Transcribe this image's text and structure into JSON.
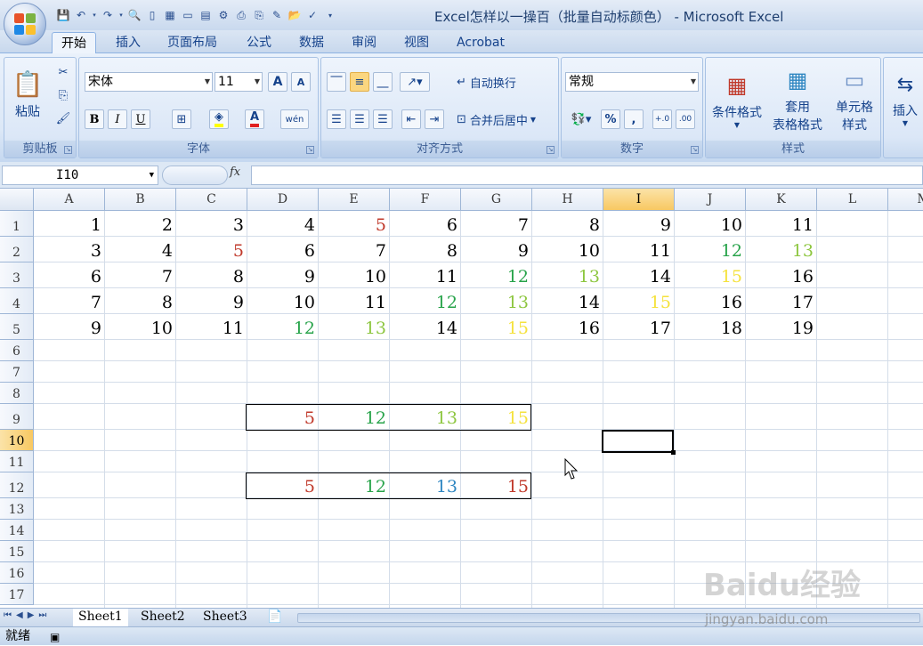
{
  "window": {
    "title": "Excel怎样以一操百（批量自动标颜色） - Microsoft Excel"
  },
  "tabs": [
    "开始",
    "插入",
    "页面布局",
    "公式",
    "数据",
    "审阅",
    "视图",
    "Acrobat"
  ],
  "ribbon": {
    "clipboard": {
      "label": "剪贴板",
      "paste": "粘贴"
    },
    "font": {
      "label": "字体",
      "name": "宋体",
      "size": "11",
      "grow": "A",
      "shrink": "A",
      "bold": "B",
      "italic": "I",
      "underline": "U",
      "fontcolor": "A",
      "phonetic": "wén"
    },
    "align": {
      "label": "对齐方式",
      "wrap": "自动换行",
      "merge": "合并后居中"
    },
    "number": {
      "label": "数字",
      "format": "常规",
      "percent": "%",
      "comma": ","
    },
    "styles": {
      "label": "样式",
      "cond": "条件格式",
      "table_line1": "套用",
      "table_line2": "表格格式",
      "cell_line1": "单元格",
      "cell_line2": "样式"
    },
    "cells": {
      "insert": "插入"
    }
  },
  "formula_bar": {
    "name_box": "I10",
    "fx": "fx",
    "formula": ""
  },
  "columns": [
    "A",
    "B",
    "C",
    "D",
    "E",
    "F",
    "G",
    "H",
    "I",
    "J",
    "K",
    "L",
    "M"
  ],
  "rows": [
    "1",
    "2",
    "3",
    "4",
    "5",
    "6",
    "7",
    "8",
    "9",
    "10",
    "11",
    "12",
    "13",
    "14",
    "15",
    "16",
    "17"
  ],
  "selected": {
    "column": "I",
    "row": "10"
  },
  "colors": {
    "red": "#c0392b",
    "green": "#27a34a",
    "lightgreen": "#8dc63f",
    "yellow": "#f5e23d",
    "blue": "#2e86c1",
    "black": "#000000"
  },
  "cells": [
    {
      "r": 1,
      "c": 0,
      "v": "1",
      "k": "black"
    },
    {
      "r": 1,
      "c": 1,
      "v": "2",
      "k": "black"
    },
    {
      "r": 1,
      "c": 2,
      "v": "3",
      "k": "black"
    },
    {
      "r": 1,
      "c": 3,
      "v": "4",
      "k": "black"
    },
    {
      "r": 1,
      "c": 4,
      "v": "5",
      "k": "red"
    },
    {
      "r": 1,
      "c": 5,
      "v": "6",
      "k": "black"
    },
    {
      "r": 1,
      "c": 6,
      "v": "7",
      "k": "black"
    },
    {
      "r": 1,
      "c": 7,
      "v": "8",
      "k": "black"
    },
    {
      "r": 1,
      "c": 8,
      "v": "9",
      "k": "black"
    },
    {
      "r": 1,
      "c": 9,
      "v": "10",
      "k": "black"
    },
    {
      "r": 1,
      "c": 10,
      "v": "11",
      "k": "black"
    },
    {
      "r": 2,
      "c": 0,
      "v": "3",
      "k": "black"
    },
    {
      "r": 2,
      "c": 1,
      "v": "4",
      "k": "black"
    },
    {
      "r": 2,
      "c": 2,
      "v": "5",
      "k": "red"
    },
    {
      "r": 2,
      "c": 3,
      "v": "6",
      "k": "black"
    },
    {
      "r": 2,
      "c": 4,
      "v": "7",
      "k": "black"
    },
    {
      "r": 2,
      "c": 5,
      "v": "8",
      "k": "black"
    },
    {
      "r": 2,
      "c": 6,
      "v": "9",
      "k": "black"
    },
    {
      "r": 2,
      "c": 7,
      "v": "10",
      "k": "black"
    },
    {
      "r": 2,
      "c": 8,
      "v": "11",
      "k": "black"
    },
    {
      "r": 2,
      "c": 9,
      "v": "12",
      "k": "green"
    },
    {
      "r": 2,
      "c": 10,
      "v": "13",
      "k": "lightgreen"
    },
    {
      "r": 3,
      "c": 0,
      "v": "6",
      "k": "black"
    },
    {
      "r": 3,
      "c": 1,
      "v": "7",
      "k": "black"
    },
    {
      "r": 3,
      "c": 2,
      "v": "8",
      "k": "black"
    },
    {
      "r": 3,
      "c": 3,
      "v": "9",
      "k": "black"
    },
    {
      "r": 3,
      "c": 4,
      "v": "10",
      "k": "black"
    },
    {
      "r": 3,
      "c": 5,
      "v": "11",
      "k": "black"
    },
    {
      "r": 3,
      "c": 6,
      "v": "12",
      "k": "green"
    },
    {
      "r": 3,
      "c": 7,
      "v": "13",
      "k": "lightgreen"
    },
    {
      "r": 3,
      "c": 8,
      "v": "14",
      "k": "black"
    },
    {
      "r": 3,
      "c": 9,
      "v": "15",
      "k": "yellow"
    },
    {
      "r": 3,
      "c": 10,
      "v": "16",
      "k": "black"
    },
    {
      "r": 4,
      "c": 0,
      "v": "7",
      "k": "black"
    },
    {
      "r": 4,
      "c": 1,
      "v": "8",
      "k": "black"
    },
    {
      "r": 4,
      "c": 2,
      "v": "9",
      "k": "black"
    },
    {
      "r": 4,
      "c": 3,
      "v": "10",
      "k": "black"
    },
    {
      "r": 4,
      "c": 4,
      "v": "11",
      "k": "black"
    },
    {
      "r": 4,
      "c": 5,
      "v": "12",
      "k": "green"
    },
    {
      "r": 4,
      "c": 6,
      "v": "13",
      "k": "lightgreen"
    },
    {
      "r": 4,
      "c": 7,
      "v": "14",
      "k": "black"
    },
    {
      "r": 4,
      "c": 8,
      "v": "15",
      "k": "yellow"
    },
    {
      "r": 4,
      "c": 9,
      "v": "16",
      "k": "black"
    },
    {
      "r": 4,
      "c": 10,
      "v": "17",
      "k": "black"
    },
    {
      "r": 5,
      "c": 0,
      "v": "9",
      "k": "black"
    },
    {
      "r": 5,
      "c": 1,
      "v": "10",
      "k": "black"
    },
    {
      "r": 5,
      "c": 2,
      "v": "11",
      "k": "black"
    },
    {
      "r": 5,
      "c": 3,
      "v": "12",
      "k": "green"
    },
    {
      "r": 5,
      "c": 4,
      "v": "13",
      "k": "lightgreen"
    },
    {
      "r": 5,
      "c": 5,
      "v": "14",
      "k": "black"
    },
    {
      "r": 5,
      "c": 6,
      "v": "15",
      "k": "yellow"
    },
    {
      "r": 5,
      "c": 7,
      "v": "16",
      "k": "black"
    },
    {
      "r": 5,
      "c": 8,
      "v": "17",
      "k": "black"
    },
    {
      "r": 5,
      "c": 9,
      "v": "18",
      "k": "black"
    },
    {
      "r": 5,
      "c": 10,
      "v": "19",
      "k": "black"
    },
    {
      "r": 9,
      "c": 3,
      "v": "5",
      "k": "red"
    },
    {
      "r": 9,
      "c": 4,
      "v": "12",
      "k": "green"
    },
    {
      "r": 9,
      "c": 5,
      "v": "13",
      "k": "lightgreen"
    },
    {
      "r": 9,
      "c": 6,
      "v": "15",
      "k": "yellow"
    },
    {
      "r": 12,
      "c": 3,
      "v": "5",
      "k": "red"
    },
    {
      "r": 12,
      "c": 4,
      "v": "12",
      "k": "green"
    },
    {
      "r": 12,
      "c": 5,
      "v": "13",
      "k": "blue"
    },
    {
      "r": 12,
      "c": 6,
      "v": "15",
      "k": "red"
    }
  ],
  "sheets": [
    "Sheet1",
    "Sheet2",
    "Sheet3"
  ],
  "status": {
    "text": "就绪"
  },
  "watermark": {
    "line1": "Baidu经验",
    "line2": "jingyan.baidu.com"
  }
}
